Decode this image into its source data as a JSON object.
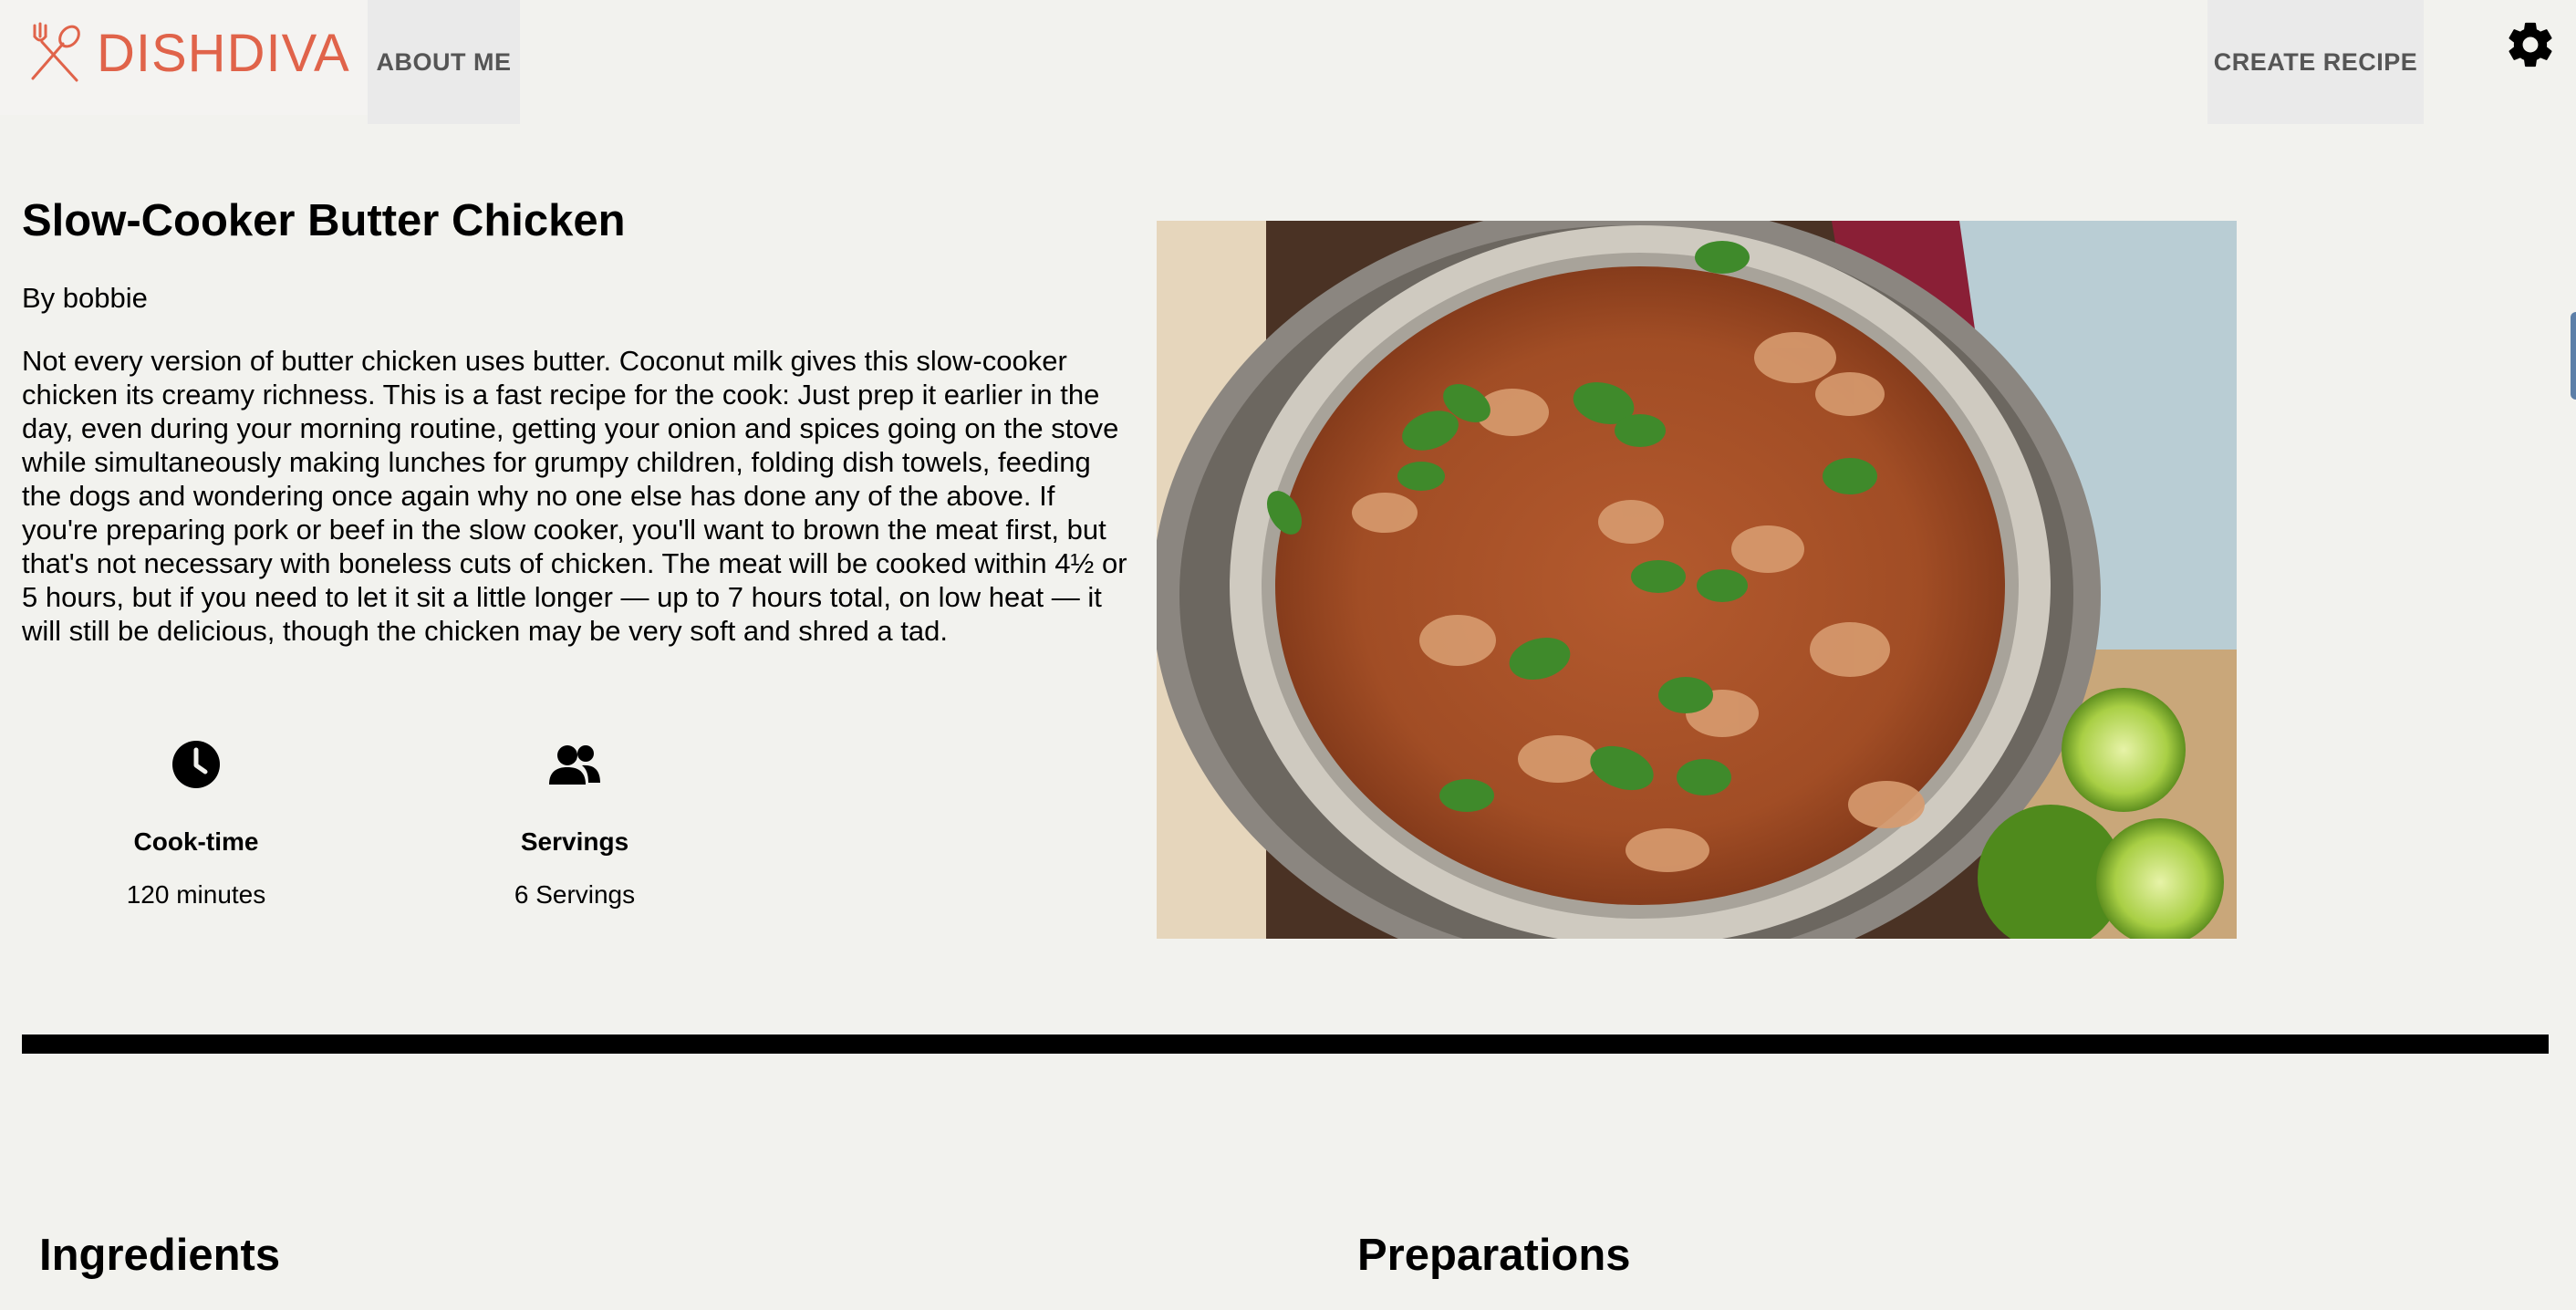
{
  "header": {
    "logo_text": "DISHDIVA",
    "brand_color": "#e0634a",
    "logo_icon": "fork-spoon-icon",
    "nav": {
      "about_label": "ABOUT ME",
      "create_label": "CREATE RECIPE"
    },
    "settings_icon": "gear-icon"
  },
  "recipe": {
    "title": "Slow-Cooker Butter Chicken",
    "author": "By bobbie",
    "description": "Not every version of butter chicken uses butter. Coconut milk gives this slow-cooker chicken its creamy richness. This is a fast recipe for the cook: Just prep it earlier in the day, even during your morning routine, getting your onion and spices going on the stove while simultaneously making lunches for grumpy children, folding dish towels, feeding the dogs and wondering once again why no one else has done any of the above. If you're preparing pork or beef in the slow cooker, you'll want to brown the meat first, but that's not necessary with boneless cuts of chicken. The meat will be cooked within 4½ or 5 hours, but if you need to let it sit a little longer — up to 7 hours total, on low heat — it will still be delicious, though the chicken may be very soft and shred a tad.",
    "cook_time": {
      "icon": "clock-icon",
      "label": "Cook-time",
      "value": "120 minutes"
    },
    "servings": {
      "icon": "people-icon",
      "label": "Servings",
      "value": "6 Servings"
    },
    "photo_icon": "butter-chicken-photo"
  },
  "sections": {
    "ingredients_title": "Ingredients",
    "preparations_title": "Preparations"
  }
}
